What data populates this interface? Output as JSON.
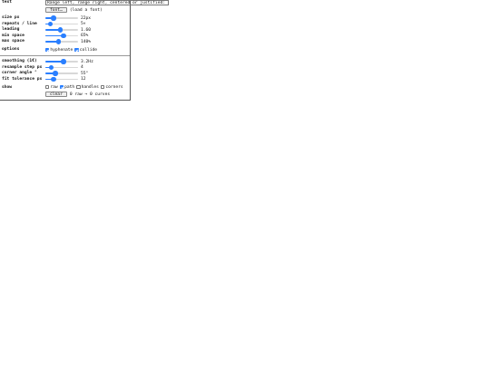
{
  "panel": {
    "text_label": "text",
    "text_value": "Range left, range right, centered or justified:",
    "font_button": "font…",
    "font_hint": "(load a font)",
    "sliders_top": [
      {
        "label": "size px",
        "value": "22px",
        "fraction": 0.25
      },
      {
        "label": "repeats / line",
        "value": "5×",
        "fraction": 0.15
      },
      {
        "label": "leading",
        "value": "1.60",
        "fraction": 0.45
      },
      {
        "label": "min space",
        "value": "65%",
        "fraction": 0.55
      },
      {
        "label": "max space",
        "value": "140%",
        "fraction": 0.4
      }
    ],
    "options_label": "options",
    "options": [
      {
        "label": "hyphenate",
        "checked": true
      },
      {
        "label": "collide",
        "checked": true
      }
    ],
    "sliders_bottom": [
      {
        "label": "smoothing (1€)",
        "value": "3.2Hz",
        "fraction": 0.55
      },
      {
        "label": "resample step px",
        "value": "4",
        "fraction": 0.18
      },
      {
        "label": "corner angle °",
        "value": "55°",
        "fraction": 0.3
      },
      {
        "label": "fit tolerance px",
        "value": "12",
        "fraction": 0.25
      }
    ],
    "show_label": "show",
    "show": [
      {
        "label": "raw",
        "checked": false
      },
      {
        "label": "path",
        "checked": true
      },
      {
        "label": "handles",
        "checked": false
      },
      {
        "label": "corners",
        "checked": false
      }
    ],
    "clear_button": "clear",
    "status": "0 raw → 0 curves"
  },
  "colors": {
    "accent": "#2a7fff"
  }
}
